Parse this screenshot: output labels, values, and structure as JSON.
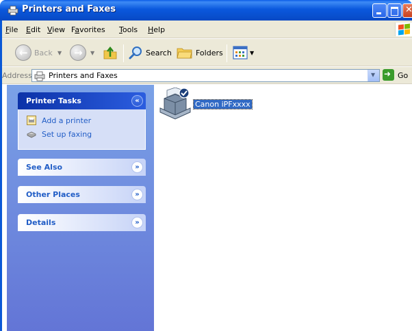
{
  "window": {
    "title": "Printers and Faxes"
  },
  "menubar": {
    "items": [
      {
        "label": "File",
        "u": "F",
        "rest": "ile"
      },
      {
        "label": "Edit",
        "u": "E",
        "rest": "dit"
      },
      {
        "label": "View",
        "u": "V",
        "rest": "iew"
      },
      {
        "label": "Favorites",
        "pre": "F",
        "u": "a",
        "rest": "vorites"
      },
      {
        "label": "Tools",
        "u": "T",
        "rest": "ools"
      },
      {
        "label": "Help",
        "u": "H",
        "rest": "elp"
      }
    ]
  },
  "toolbar": {
    "back_label": "Back",
    "search_label": "Search",
    "folders_label": "Folders"
  },
  "address": {
    "label": "Address",
    "value": "Printers and Faxes",
    "go_label": "Go"
  },
  "taskpane": {
    "printer_tasks": {
      "title": "Printer Tasks",
      "chevron": "«",
      "items": [
        {
          "label": "Add a printer",
          "icon": "add-printer-icon"
        },
        {
          "label": "Set up faxing",
          "icon": "fax-icon"
        }
      ]
    },
    "see_also": {
      "title": "See Also",
      "chevron": "»"
    },
    "other_places": {
      "title": "Other Places",
      "chevron": "»"
    },
    "details": {
      "title": "Details",
      "chevron": "»"
    }
  },
  "content": {
    "printers": [
      {
        "name": "Canon iPFxxxx",
        "default": true,
        "selected": true
      }
    ]
  },
  "colors": {
    "titlebar": "#0a58dd",
    "taskpane_bg": "#7ba2e7",
    "task_link": "#215dc6",
    "selection": "#316ac5"
  }
}
